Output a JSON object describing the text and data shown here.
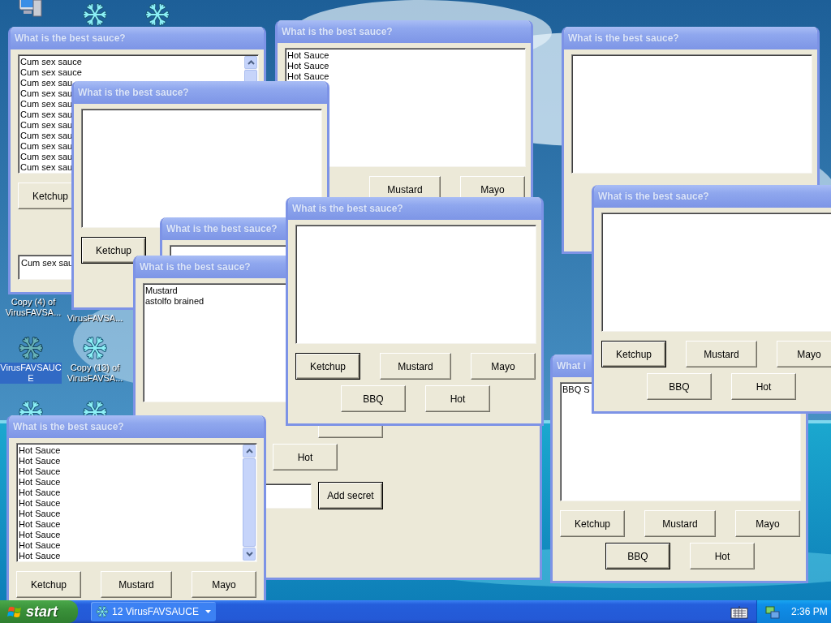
{
  "desktop_icons": [
    {
      "kind": "computer",
      "selected": false
    },
    {
      "kind": "snowflake",
      "selected": false
    },
    {
      "kind": "snowflake",
      "selected": false
    },
    {
      "label": "Copy (4) of VirusFAVSA...",
      "selected": false
    },
    {
      "label": "VirusFAVSA...",
      "selected": false
    },
    {
      "kind": "snowflake",
      "label": "VirusFAVSAUCE",
      "selected": true
    },
    {
      "kind": "snowflake",
      "label": "Copy (13) of VirusFAVSA...",
      "selected": false
    },
    {
      "kind": "snowflake",
      "selected": false
    },
    {
      "kind": "snowflake",
      "selected": false
    }
  ],
  "windows": [
    {
      "title": "What is the best sauce?",
      "list": {
        "scrollable": true,
        "items": [
          "Cum sex sauce",
          "Cum sex sauce",
          "Cum sex sau",
          "Cum sex sau",
          "Cum sex sau",
          "Cum sex sau",
          "Cum sex sau",
          "Cum sex sau",
          "Cum sex sau",
          "Cum sex sau",
          "Cum sex sau"
        ]
      },
      "row_1": [
        {
          "label": "Ketchup",
          "focused": false
        }
      ],
      "field": {
        "kind": "text",
        "value": "Cum sex sau"
      }
    },
    {
      "title": "What is the best sauce?",
      "list": {
        "scrollable": false,
        "items": [
          "Hot Sauce",
          "Hot Sauce",
          "Hot Sauce"
        ]
      },
      "row_1": [
        {
          "label": "Mustard",
          "focused": false
        },
        {
          "label": "Mayo",
          "focused": false
        }
      ]
    },
    {
      "title": "What is the best sauce?",
      "list": {
        "scrollable": false
      }
    },
    {
      "title": "What is the best sauce?",
      "list": {
        "scrollable": false
      },
      "row_1": [
        {
          "label": "Ketchup",
          "focused": true
        }
      ]
    },
    {
      "title": "What is the best sauce?"
    },
    {
      "title": "What is the best sauce?",
      "list": {
        "items": [
          "Mustard",
          "astolfo brained"
        ]
      },
      "row_1": [
        {
          "focused": false
        }
      ],
      "row_2": [
        {
          "label": "Hot",
          "focused": false
        }
      ],
      "field": {
        "kind": "text"
      },
      "secret_button": {
        "label": "Add secret",
        "focused": true
      }
    },
    {
      "title": "What is the best sauce?",
      "list": {
        "scrollable": true,
        "items": [
          "Hot Sauce",
          "Hot Sauce",
          "Hot Sauce",
          "Hot Sauce",
          "Hot Sauce",
          "Hot Sauce",
          "Hot Sauce",
          "Hot Sauce",
          "Hot Sauce",
          "Hot Sauce",
          "Hot Sauce"
        ]
      },
      "row_1": [
        {
          "label": "Ketchup",
          "focused": false
        },
        {
          "label": "Mustard",
          "focused": false
        },
        {
          "label": "Mayo",
          "focused": false
        }
      ]
    },
    {
      "title": "What is the best sauce?",
      "list": {
        "scrollable": false
      },
      "row_1": [
        {
          "label": "Ketchup",
          "focused": true
        },
        {
          "label": "Mustard",
          "focused": false
        },
        {
          "label": "Mayo",
          "focused": false
        }
      ],
      "row_2": [
        {
          "label": "BBQ",
          "focused": false
        },
        {
          "label": "Hot",
          "focused": false
        }
      ]
    },
    {
      "title": "What i",
      "list": {
        "scrollable": false,
        "items": [
          "BBQ S"
        ]
      },
      "row_1": [
        {
          "label": "Ketchup",
          "focused": false
        },
        {
          "label": "Mustard",
          "focused": false
        },
        {
          "label": "Mayo",
          "focused": false
        }
      ],
      "row_2": [
        {
          "label": "BBQ",
          "focused": true
        },
        {
          "label": "Hot",
          "focused": false
        }
      ]
    },
    {
      "title": "What is the best sauce?",
      "list": {
        "scrollable": false
      },
      "row_1": [
        {
          "label": "Ketchup",
          "focused": true
        },
        {
          "label": "Mustard",
          "focused": false
        },
        {
          "label": "Mayo",
          "focused": false
        }
      ],
      "row_2": [
        {
          "label": "BBQ",
          "focused": false
        },
        {
          "label": "Hot",
          "focused": false
        }
      ]
    }
  ],
  "taskbar": {
    "start_label": "start",
    "tasks": [
      {
        "label": "12 VirusFAVSAUCE",
        "selected": false
      }
    ],
    "clock": "2:36 PM"
  }
}
